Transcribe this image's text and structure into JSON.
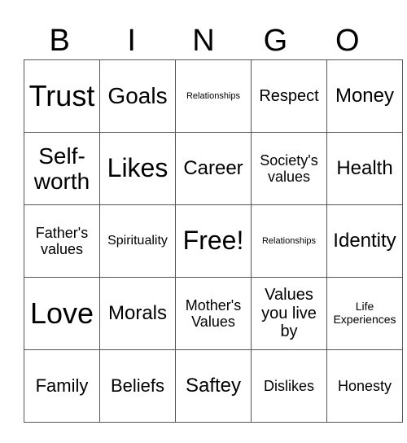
{
  "header": {
    "letters": [
      "B",
      "I",
      "N",
      "G",
      "O"
    ]
  },
  "grid": {
    "rows": [
      [
        "Trust",
        "Goals",
        "Relationships",
        "Respect",
        "Money"
      ],
      [
        "Self-worth",
        "Likes",
        "Career",
        "Society's values",
        "Health"
      ],
      [
        "Father's values",
        "Spirituality",
        "Free!",
        "Relationships",
        "Identity"
      ],
      [
        "Love",
        "Morals",
        "Mother's Values",
        "Values you live by",
        "Life Experiences"
      ],
      [
        "Family",
        "Beliefs",
        "Saftey",
        "Dislikes",
        "Honesty"
      ]
    ]
  }
}
